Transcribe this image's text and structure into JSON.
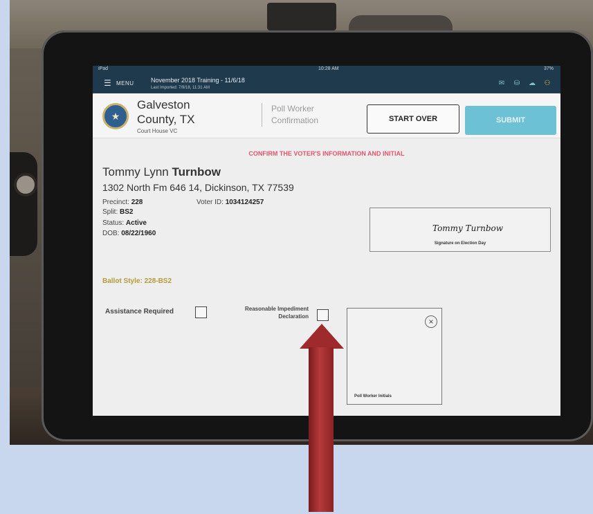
{
  "status_bar": {
    "device": "iPad",
    "time": "10:28 AM",
    "battery": "37%"
  },
  "header": {
    "menu_label": "MENU",
    "event_title": "November 2018 Training - 11/6/18",
    "event_subtitle": "Last Imported: 7/9/18, 11:31 AM",
    "icons": [
      "mail-icon",
      "database-icon",
      "cloud-upload-icon",
      "users-icon"
    ]
  },
  "county": {
    "name": "Galveston County, TX",
    "location": "Court House VC",
    "module": "Poll Worker Confirmation"
  },
  "buttons": {
    "start_over": "START OVER",
    "submit": "SUBMIT"
  },
  "instruction": "CONFIRM THE VOTER'S INFORMATION AND INITIAL",
  "voter": {
    "first_middle": "Tommy Lynn",
    "last": "Turnbow",
    "address": "1302 North Fm 646 14, Dickinson, TX 77539",
    "precinct_label": "Precinct:",
    "precinct": "228",
    "voter_id_label": "Voter ID:",
    "voter_id": "1034124257",
    "split_label": "Split:",
    "split": "BS2",
    "status_label": "Status:",
    "status": "Active",
    "dob_label": "DOB:",
    "dob": "08/22/1960"
  },
  "signature": {
    "label": "Signature on Election Day",
    "value": "Tommy Turnbow"
  },
  "ballot_style": "Ballot Style: 228-BS2",
  "assistance_label": "Assistance Required",
  "rid_label": "Reasonable Impediment Declaration",
  "initials_label": "Poll Worker Initials",
  "colors": {
    "header": "#1f3a4d",
    "submit": "#6cc1d4",
    "instruction": "#e2556b",
    "ballot": "#b59a3a",
    "arrow": "#9e2a2c"
  }
}
